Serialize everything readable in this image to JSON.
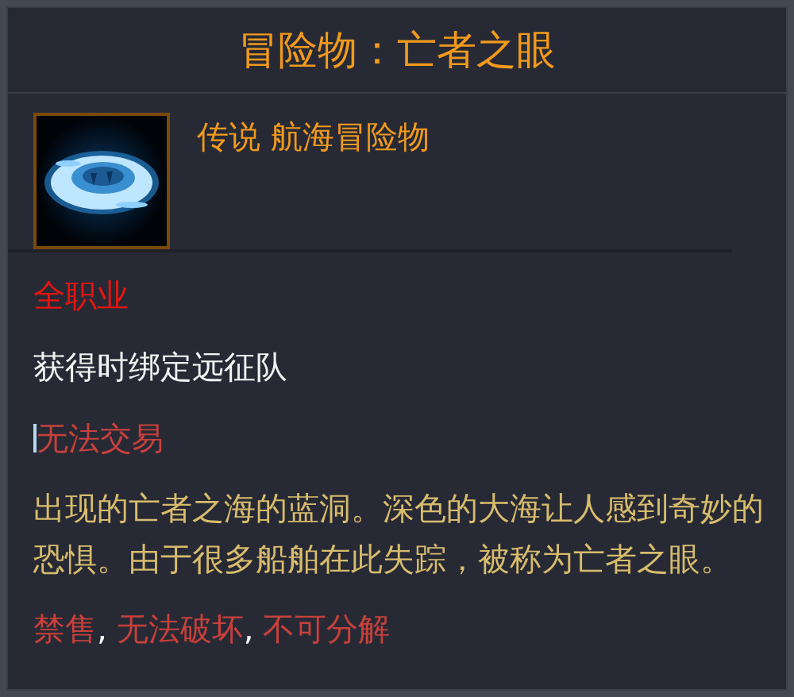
{
  "title": "冒险物：亡者之眼",
  "item": {
    "kind": "picture",
    "subtitle": "传说 航海冒险物"
  },
  "lines": [
    {
      "kind": "plain",
      "text": "全职业",
      "color": "#e8140f"
    },
    {
      "kind": "plain",
      "text": "获得时绑定远征队",
      "color": "#f2f2f2"
    },
    {
      "kind": "cursor",
      "text": "无法交易",
      "color": "#c8403b"
    },
    {
      "kind": "description",
      "text": "出现的亡者之海的蓝洞。深色的大海让人感到奇妙的恐惧。由于很多船舶在此失踪，被称为亡者之眼。",
      "color": "#d8bc6c"
    }
  ],
  "restrictions": {
    "items": [
      "禁售",
      "无法破坏",
      "不可分解"
    ],
    "separator": ",",
    "color": "#c8403b"
  }
}
